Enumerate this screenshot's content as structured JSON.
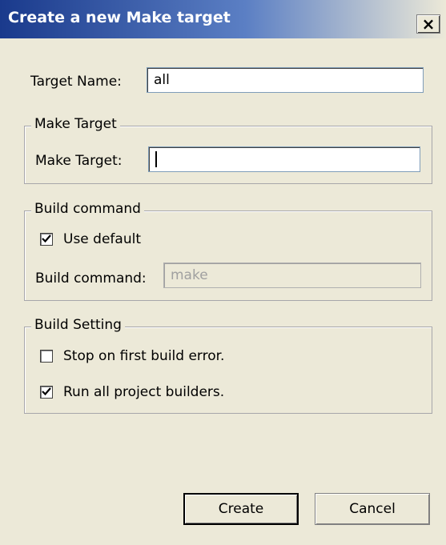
{
  "window": {
    "title": "Create a new Make target",
    "close_glyph": "×"
  },
  "target_name": {
    "label": "Target Name:",
    "value": "all"
  },
  "make_target_group": {
    "legend": "Make Target",
    "label": "Make Target:",
    "value": ""
  },
  "build_command_group": {
    "legend": "Build command",
    "use_default": {
      "label": "Use default",
      "checked": true
    },
    "command_label": "Build command:",
    "command_value": "make",
    "command_enabled": false
  },
  "build_setting_group": {
    "legend": "Build Setting",
    "stop_on_error": {
      "label": "Stop on first build error.",
      "checked": false
    },
    "run_all_builders": {
      "label": "Run all project builders.",
      "checked": true
    }
  },
  "buttons": {
    "create": "Create",
    "cancel": "Cancel"
  }
}
